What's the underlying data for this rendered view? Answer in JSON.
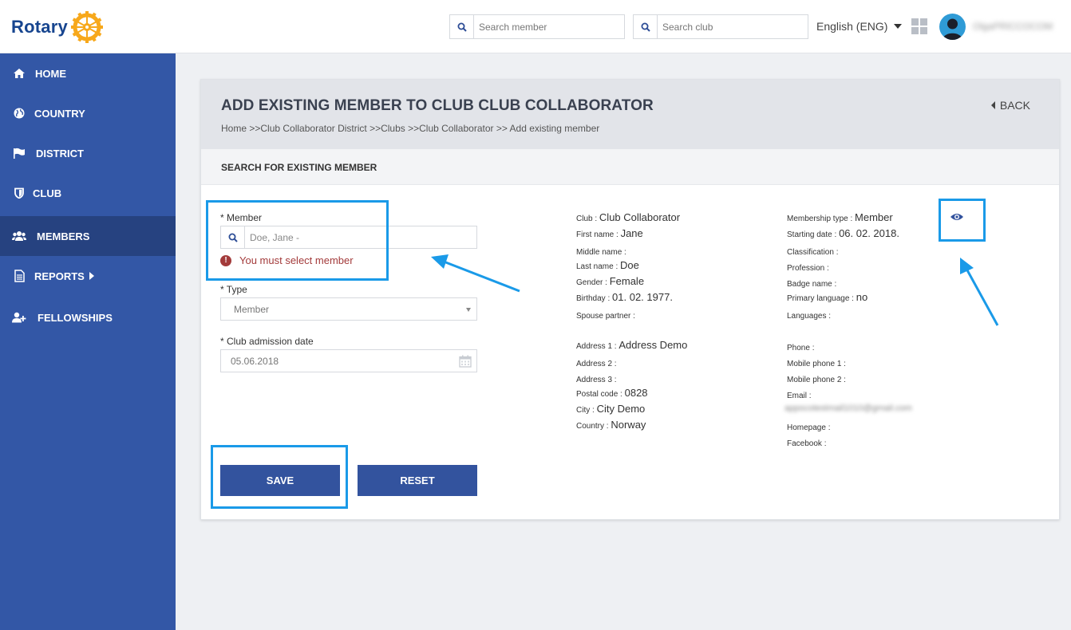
{
  "brand": {
    "name": "Rotary",
    "color": "#17458f",
    "accent": "#f7a81b"
  },
  "header": {
    "search_member_placeholder": "Search member",
    "search_club_placeholder": "Search club",
    "language": "English (ENG)",
    "username": "OlgaPRICCOCOM"
  },
  "sidebar": {
    "items": [
      {
        "label": "HOME",
        "icon": "home-icon"
      },
      {
        "label": "COUNTRY",
        "icon": "globe-icon"
      },
      {
        "label": "DISTRICT",
        "icon": "flag-icon"
      },
      {
        "label": "CLUB",
        "icon": "shield-icon"
      },
      {
        "label": "MEMBERS",
        "icon": "users-icon",
        "active": true
      },
      {
        "label": "REPORTS",
        "icon": "document-icon"
      },
      {
        "label": "FELLOWSHIPS",
        "icon": "user-plus-icon"
      }
    ]
  },
  "page": {
    "title": "ADD EXISTING MEMBER TO CLUB CLUB COLLABORATOR",
    "breadcrumb": "Home >>Club Collaborator District >>Clubs >>Club Collaborator >> Add existing member",
    "back_label": "BACK",
    "section_title": "SEARCH FOR EXISTING MEMBER"
  },
  "form": {
    "member_label": "* Member",
    "member_placeholder": "Doe, Jane -",
    "member_error": "You must select member",
    "type_label": "* Type",
    "type_value": "Member",
    "admission_label": "* Club admission date",
    "admission_value": "05.06.2018",
    "save_label": "SAVE",
    "reset_label": "RESET"
  },
  "details_left": [
    {
      "label": "Club",
      "value": "Club Collaborator"
    },
    {
      "label": "First name",
      "value": "Jane"
    },
    {
      "label": "Middle name",
      "value": ""
    },
    {
      "label": "Last name",
      "value": "Doe"
    },
    {
      "label": "Gender",
      "value": "Female"
    },
    {
      "label": "Birthday",
      "value": "01. 02. 1977."
    },
    {
      "label": "Spouse partner",
      "value": ""
    },
    {
      "label": "Address 1",
      "value": "Address Demo"
    },
    {
      "label": "Address 2",
      "value": ""
    },
    {
      "label": "Address 3",
      "value": ""
    },
    {
      "label": "Postal code",
      "value": "0828"
    },
    {
      "label": "City",
      "value": "City Demo"
    },
    {
      "label": "Country",
      "value": "Norway"
    }
  ],
  "details_right": [
    {
      "label": "Membership type",
      "value": "Member"
    },
    {
      "label": "Starting date",
      "value": "06. 02. 2018."
    },
    {
      "label": "Classification",
      "value": ""
    },
    {
      "label": "Profession",
      "value": ""
    },
    {
      "label": "Badge name",
      "value": ""
    },
    {
      "label": "Primary language",
      "value": "no"
    },
    {
      "label": "Languages",
      "value": ""
    },
    {
      "label": "Phone",
      "value": ""
    },
    {
      "label": "Mobile phone 1",
      "value": ""
    },
    {
      "label": "Mobile phone 2",
      "value": ""
    },
    {
      "label": "Email",
      "value": ""
    },
    {
      "label": "Homepage",
      "value": ""
    },
    {
      "label": "Facebook",
      "value": ""
    }
  ],
  "email_blurred": "appocotestmail1010@gmail.com"
}
